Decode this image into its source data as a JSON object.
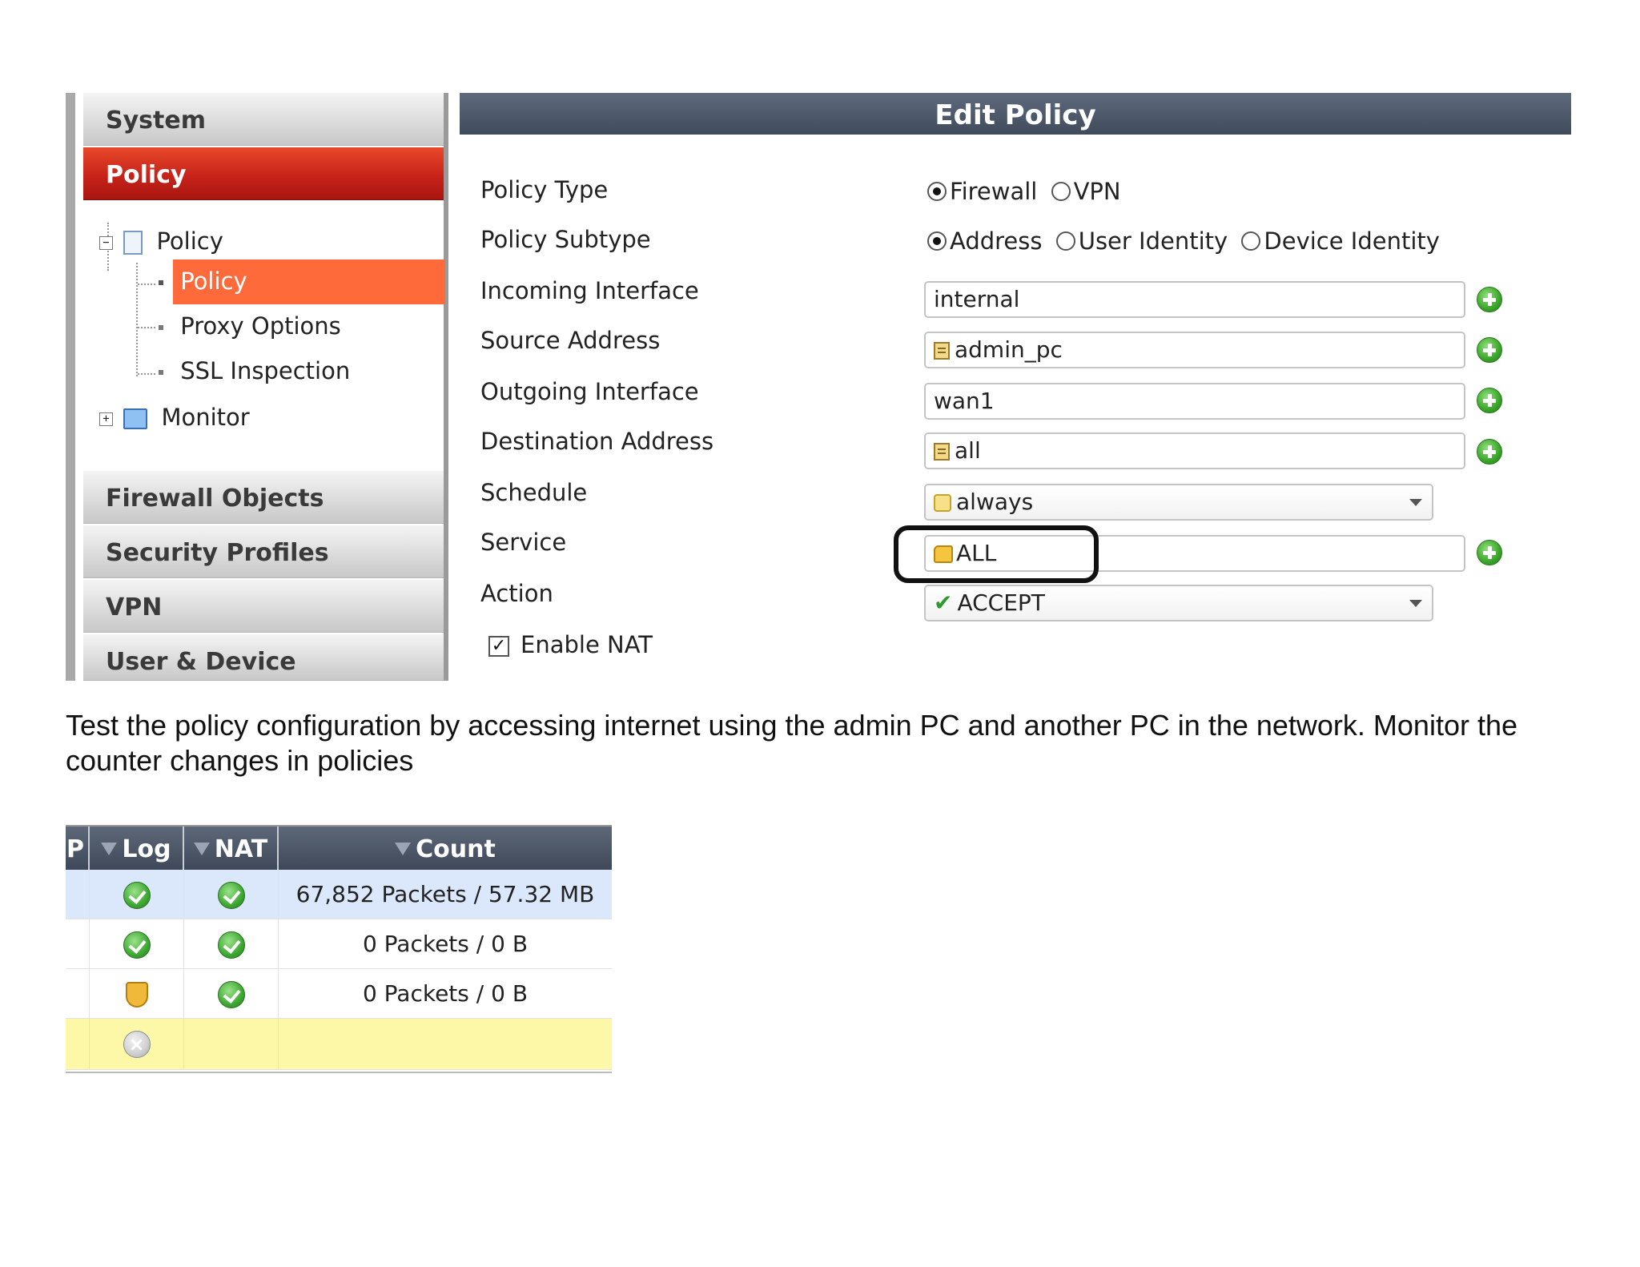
{
  "sidebar": {
    "sections": [
      "System",
      "Policy",
      "Firewall Objects",
      "Security Profiles",
      "VPN",
      "User & Device"
    ],
    "tree": {
      "policy_group": "Policy",
      "children": [
        "Policy",
        "Proxy Options",
        "SSL Inspection"
      ],
      "monitor": "Monitor"
    }
  },
  "edit_policy": {
    "title": "Edit Policy",
    "labels": {
      "policy_type": "Policy Type",
      "policy_subtype": "Policy Subtype",
      "incoming_interface": "Incoming Interface",
      "source_address": "Source Address",
      "outgoing_interface": "Outgoing Interface",
      "destination_address": "Destination Address",
      "schedule": "Schedule",
      "service": "Service",
      "action": "Action",
      "enable_nat": "Enable NAT"
    },
    "policy_type_options": [
      "Firewall",
      "VPN"
    ],
    "policy_type_selected": "Firewall",
    "policy_subtype_options": [
      "Address",
      "User Identity",
      "Device Identity"
    ],
    "policy_subtype_selected": "Address",
    "values": {
      "incoming_interface": "internal",
      "source_address": "admin_pc",
      "outgoing_interface": "wan1",
      "destination_address": "all",
      "schedule": "always",
      "service": "ALL",
      "action": "ACCEPT"
    },
    "enable_nat_checked": true
  },
  "instruction": "Test the policy configuration by accessing internet using the admin PC and another PC in the network. Monitor the counter changes in policies",
  "counter_table": {
    "columns": [
      "P",
      "Log",
      "NAT",
      "Count"
    ],
    "rows": [
      {
        "log": "ok-icon",
        "nat": "ok-icon",
        "count": "67,852 Packets / 57.32 MB"
      },
      {
        "log": "ok-icon",
        "nat": "ok-icon",
        "count": "0 Packets / 0 B"
      },
      {
        "log": "shield-icon",
        "nat": "ok-icon",
        "count": "0 Packets / 0 B"
      },
      {
        "log": "deny-icon",
        "nat": "",
        "count": ""
      }
    ],
    "row_colors": [
      "#dbe8fb",
      "#ffffff",
      "#ffffff",
      "#fdf8a8"
    ]
  },
  "colors": {
    "accent_red": "#c7231a",
    "selected_orange": "#ff6a3a",
    "header_slate": "#4a5566"
  }
}
